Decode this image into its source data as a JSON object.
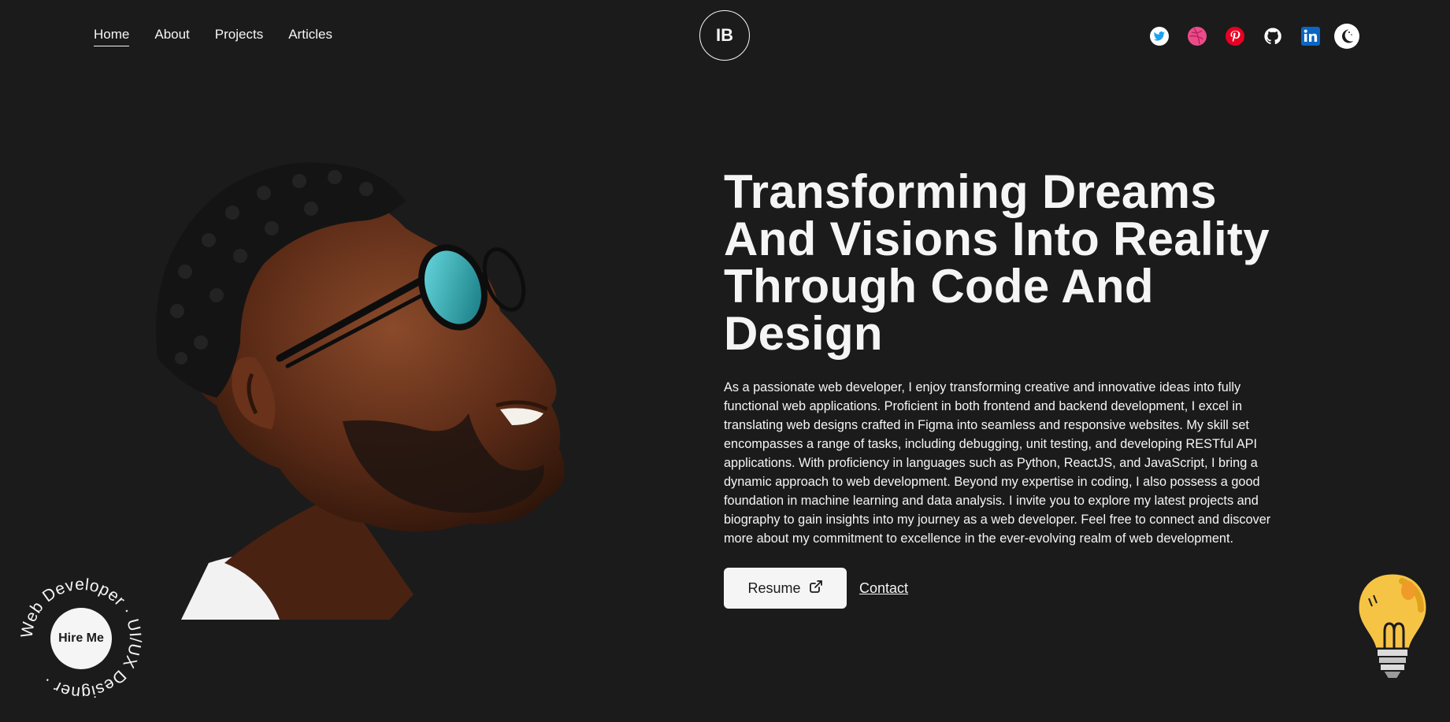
{
  "nav": {
    "items": [
      {
        "label": "Home",
        "active": true
      },
      {
        "label": "About",
        "active": false
      },
      {
        "label": "Projects",
        "active": false
      },
      {
        "label": "Articles",
        "active": false
      }
    ]
  },
  "logo": {
    "text": "IB"
  },
  "socials": [
    {
      "icon": "twitter-icon",
      "color": "#1DA1F2"
    },
    {
      "icon": "dribbble-icon",
      "color": "#EA4C89"
    },
    {
      "icon": "pinterest-icon",
      "color": "#E60023"
    },
    {
      "icon": "github-icon",
      "color": "#ffffff"
    },
    {
      "icon": "linkedin-icon",
      "color": "#0A66C2"
    }
  ],
  "theme_toggle": {
    "icon": "moon-icon"
  },
  "hero": {
    "title_lines": [
      "Transforming Dreams",
      "And Visions Into Reality",
      "Through Code And",
      "Design"
    ],
    "body_lines": [
      "As a passionate web developer, I enjoy transforming creative and innovative ideas into fully",
      "functional web applications. Proficient in both frontend and backend development, I excel in",
      "translating web designs crafted in Figma into seamless and responsive websites. My skill set",
      "encompasses a range of tasks, including debugging, unit testing, and developing RESTful API",
      "applications. With proficiency in languages such as Python, ReactJS, and JavaScript, I bring a",
      "dynamic approach to web development. Beyond my expertise in coding, I also possess a good",
      "foundation in machine learning and data analysis. I invite you to explore my latest projects and",
      "biography to gain insights into my journey as a web developer. Feel free to connect and discover",
      "more about my commitment to excellence in the ever-evolving realm of web development."
    ],
    "resume_label": "Resume",
    "contact_label": "Contact"
  },
  "hire": {
    "button_label": "Hire Me",
    "ring_text": "Web Developer · UI/UX Designer · "
  },
  "colors": {
    "background": "#1b1b1b",
    "foreground": "#f5f5f5",
    "bulb_yellow": "#f6c445"
  }
}
